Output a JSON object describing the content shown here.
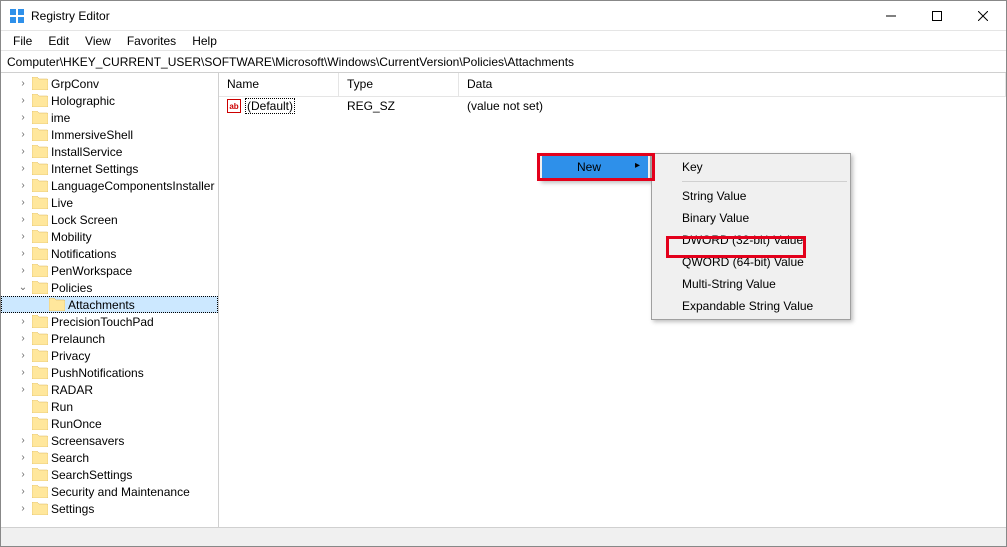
{
  "window": {
    "title": "Registry Editor"
  },
  "menus": [
    "File",
    "Edit",
    "View",
    "Favorites",
    "Help"
  ],
  "address": "Computer\\HKEY_CURRENT_USER\\SOFTWARE\\Microsoft\\Windows\\CurrentVersion\\Policies\\Attachments",
  "tree": {
    "items": [
      {
        "label": "GrpConv",
        "indent": 1,
        "expander": ">"
      },
      {
        "label": "Holographic",
        "indent": 1,
        "expander": ">"
      },
      {
        "label": "ime",
        "indent": 1,
        "expander": ">"
      },
      {
        "label": "ImmersiveShell",
        "indent": 1,
        "expander": ">"
      },
      {
        "label": "InstallService",
        "indent": 1,
        "expander": ">"
      },
      {
        "label": "Internet Settings",
        "indent": 1,
        "expander": ">"
      },
      {
        "label": "LanguageComponentsInstaller",
        "indent": 1,
        "expander": ">"
      },
      {
        "label": "Live",
        "indent": 1,
        "expander": ">"
      },
      {
        "label": "Lock Screen",
        "indent": 1,
        "expander": ">"
      },
      {
        "label": "Mobility",
        "indent": 1,
        "expander": ">"
      },
      {
        "label": "Notifications",
        "indent": 1,
        "expander": ">"
      },
      {
        "label": "PenWorkspace",
        "indent": 1,
        "expander": ">"
      },
      {
        "label": "Policies",
        "indent": 1,
        "expander": "v",
        "expanded": true
      },
      {
        "label": "Attachments",
        "indent": 2,
        "expander": "",
        "selected": true
      },
      {
        "label": "PrecisionTouchPad",
        "indent": 1,
        "expander": ">"
      },
      {
        "label": "Prelaunch",
        "indent": 1,
        "expander": ">"
      },
      {
        "label": "Privacy",
        "indent": 1,
        "expander": ">"
      },
      {
        "label": "PushNotifications",
        "indent": 1,
        "expander": ">"
      },
      {
        "label": "RADAR",
        "indent": 1,
        "expander": ">"
      },
      {
        "label": "Run",
        "indent": 1,
        "expander": ""
      },
      {
        "label": "RunOnce",
        "indent": 1,
        "expander": ""
      },
      {
        "label": "Screensavers",
        "indent": 1,
        "expander": ">"
      },
      {
        "label": "Search",
        "indent": 1,
        "expander": ">"
      },
      {
        "label": "SearchSettings",
        "indent": 1,
        "expander": ">"
      },
      {
        "label": "Security and Maintenance",
        "indent": 1,
        "expander": ">"
      },
      {
        "label": "Settings",
        "indent": 1,
        "expander": ">"
      }
    ]
  },
  "list": {
    "columns": {
      "name": "Name",
      "type": "Type",
      "data": "Data"
    },
    "rows": [
      {
        "icon": "ab",
        "name": "(Default)",
        "type": "REG_SZ",
        "data": "(value not set)"
      }
    ]
  },
  "context_menu_parent": {
    "items": [
      {
        "label": "New",
        "submenu": true,
        "highlight": true
      }
    ]
  },
  "context_menu_sub": {
    "items": [
      {
        "label": "Key"
      },
      {
        "sep": true
      },
      {
        "label": "String Value"
      },
      {
        "label": "Binary Value"
      },
      {
        "label": "DWORD (32-bit) Value",
        "boxed": true
      },
      {
        "label": "QWORD (64-bit) Value"
      },
      {
        "label": "Multi-String Value"
      },
      {
        "label": "Expandable String Value"
      }
    ]
  }
}
